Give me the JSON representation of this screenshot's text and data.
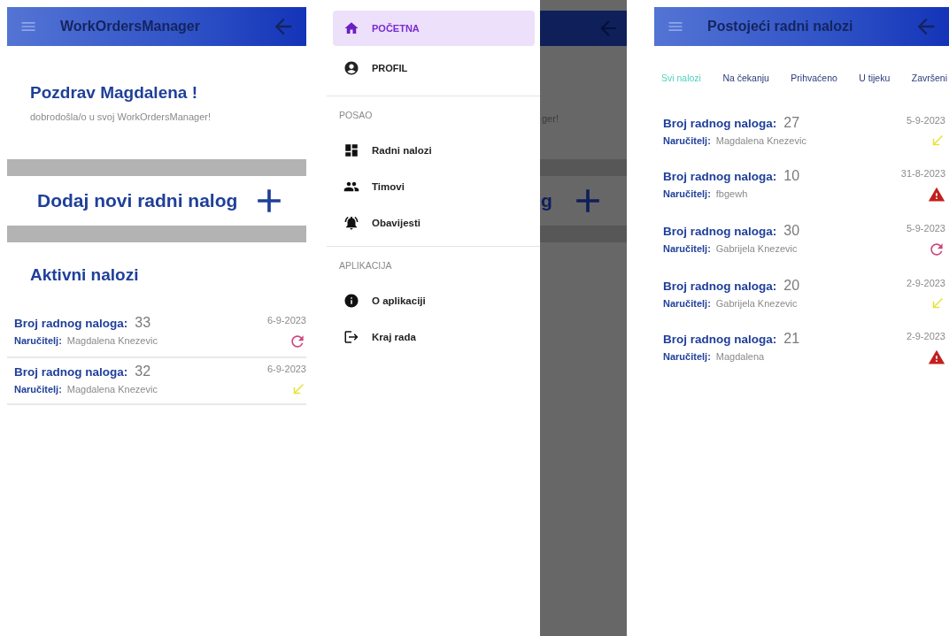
{
  "home_screen": {
    "header": {
      "title": "WorkOrdersManager"
    },
    "greeting": "Pozdrav Magdalena !",
    "welcome": "dobrodošla/o u svoj WorkOrdersManager!",
    "add_order": "Dodaj novi radni nalog",
    "active_title": "Aktivni nalozi",
    "orders": [
      {
        "number_label": "Broj radnog naloga:",
        "number": "33",
        "client_label": "Naručitelj:",
        "client": "Magdalena Knezevic",
        "date": "6-9-2023",
        "kind": "in_progress"
      },
      {
        "number_label": "Broj radnog naloga:",
        "number": "32",
        "client_label": "Naručitelj:",
        "client": "Magdalena Knezevic",
        "date": "6-9-2023",
        "kind": "accepted"
      }
    ]
  },
  "drawer_screen": {
    "top_items": [
      {
        "label": "POČETNA",
        "selected": true
      },
      {
        "label": "PROFIL",
        "selected": false
      }
    ],
    "sections": [
      {
        "title": "POSAO",
        "items": [
          {
            "label": "Radni nalozi",
            "selected": false
          },
          {
            "label": "Timovi",
            "selected": false
          },
          {
            "label": "Obavijesti",
            "selected": false
          }
        ]
      },
      {
        "title": "APLIKACIJA",
        "items": [
          {
            "label": "O aplikaciji",
            "selected": false
          },
          {
            "label": "Kraj rada",
            "selected": false
          }
        ]
      }
    ],
    "backdrop": {
      "welcome_fragment": "ger!",
      "add_fragment": "g"
    }
  },
  "orders_screen": {
    "header": {
      "title": "Postojeći radni nalozi"
    },
    "filters": [
      {
        "label": "Svi nalozi",
        "selected": true
      },
      {
        "label": "Na čekanju",
        "selected": false
      },
      {
        "label": "Prihvaćeno",
        "selected": false
      },
      {
        "label": "U tijeku",
        "selected": false
      },
      {
        "label": "Završeni",
        "selected": false
      }
    ],
    "orders": [
      {
        "number_label": "Broj radnog naloga:",
        "number": "27",
        "client_label": "Naručitelj:",
        "client": "Magdalena Knezevic",
        "date": "5-9-2023",
        "kind": "accepted"
      },
      {
        "number_label": "Broj radnog naloga:",
        "number": "10",
        "client_label": "Naručitelj:",
        "client": "fbgewh",
        "date": "31-8-2023",
        "kind": "pending"
      },
      {
        "number_label": "Broj radnog naloga:",
        "number": "30",
        "client_label": "Naručitelj:",
        "client": "Gabrijela Knezevic",
        "date": "5-9-2023",
        "kind": "in_progress"
      },
      {
        "number_label": "Broj radnog naloga:",
        "number": "20",
        "client_label": "Naručitelj:",
        "client": "Gabrijela Knezevic",
        "date": "2-9-2023",
        "kind": "accepted"
      },
      {
        "number_label": "Broj radnog naloga:",
        "number": "21",
        "client_label": "Naručitelj:",
        "client": "Magdalena",
        "date": "2-9-2023",
        "kind": "pending"
      }
    ]
  }
}
